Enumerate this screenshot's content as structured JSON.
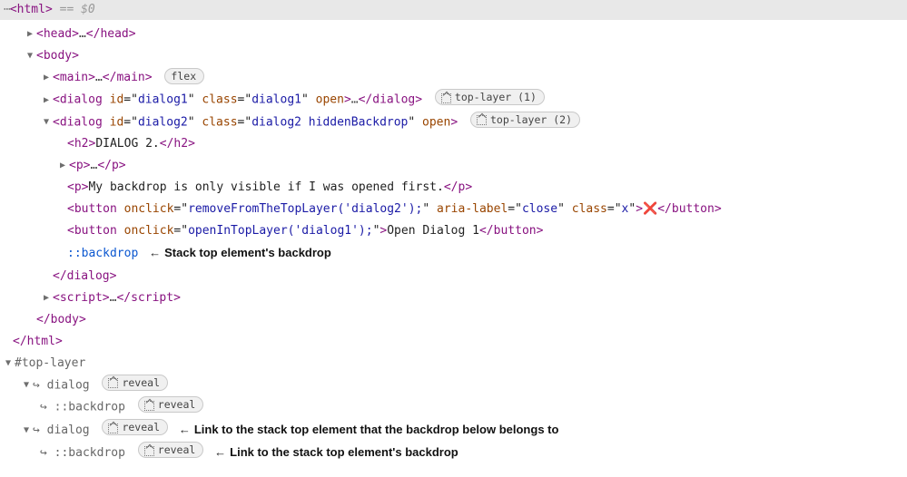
{
  "topbar": {
    "ellipsis": "⋯",
    "open": "<",
    "tag": "html",
    "close": ">",
    "suffix": " == $0"
  },
  "punct": {
    "lt": "<",
    "gt": ">",
    "lts": "</",
    "eq": "=",
    "q": "\"",
    "sp": " ",
    "ell": "…"
  },
  "tags": {
    "html": "html",
    "head": "head",
    "body": "body",
    "main": "main",
    "dialog": "dialog",
    "h2": "h2",
    "p": "p",
    "button": "button",
    "script": "script"
  },
  "attrs": {
    "id": "id",
    "class": "class",
    "open": "open",
    "onclick": "onclick",
    "aria_label": "aria-label"
  },
  "pills": {
    "flex": "flex",
    "top_layer_1": "top-layer (1)",
    "top_layer_2": "top-layer (2)",
    "reveal": "reveal"
  },
  "dialog1": {
    "id": "dialog1",
    "class": "dialog1"
  },
  "dialog2": {
    "id": "dialog2",
    "class": "dialog2 hiddenBackdrop",
    "h2_text": "DIALOG 2.",
    "p2_text": "My backdrop is only visible if I was opened first.",
    "btn_close_onclick": "removeFromTheTopLayer('dialog2');",
    "btn_close_aria": "close",
    "btn_close_class": "x",
    "btn_close_glyph": "❌",
    "btn_open_onclick": "openInTopLayer('dialog1');",
    "btn_open_text": "Open Dialog 1"
  },
  "pseudo": {
    "backdrop": "::backdrop"
  },
  "annotations": {
    "stack_top_backdrop": "Stack top element's backdrop",
    "link_to_stack_top_element": "Link to the stack top element that the backdrop below belongs to",
    "link_to_stack_top_backdrop": "Link to the stack top element's backdrop",
    "arrow": "←"
  },
  "toplayer": {
    "header": "#top-layer",
    "dialog": "dialog",
    "backdrop": "::backdrop",
    "ret": "↪"
  }
}
